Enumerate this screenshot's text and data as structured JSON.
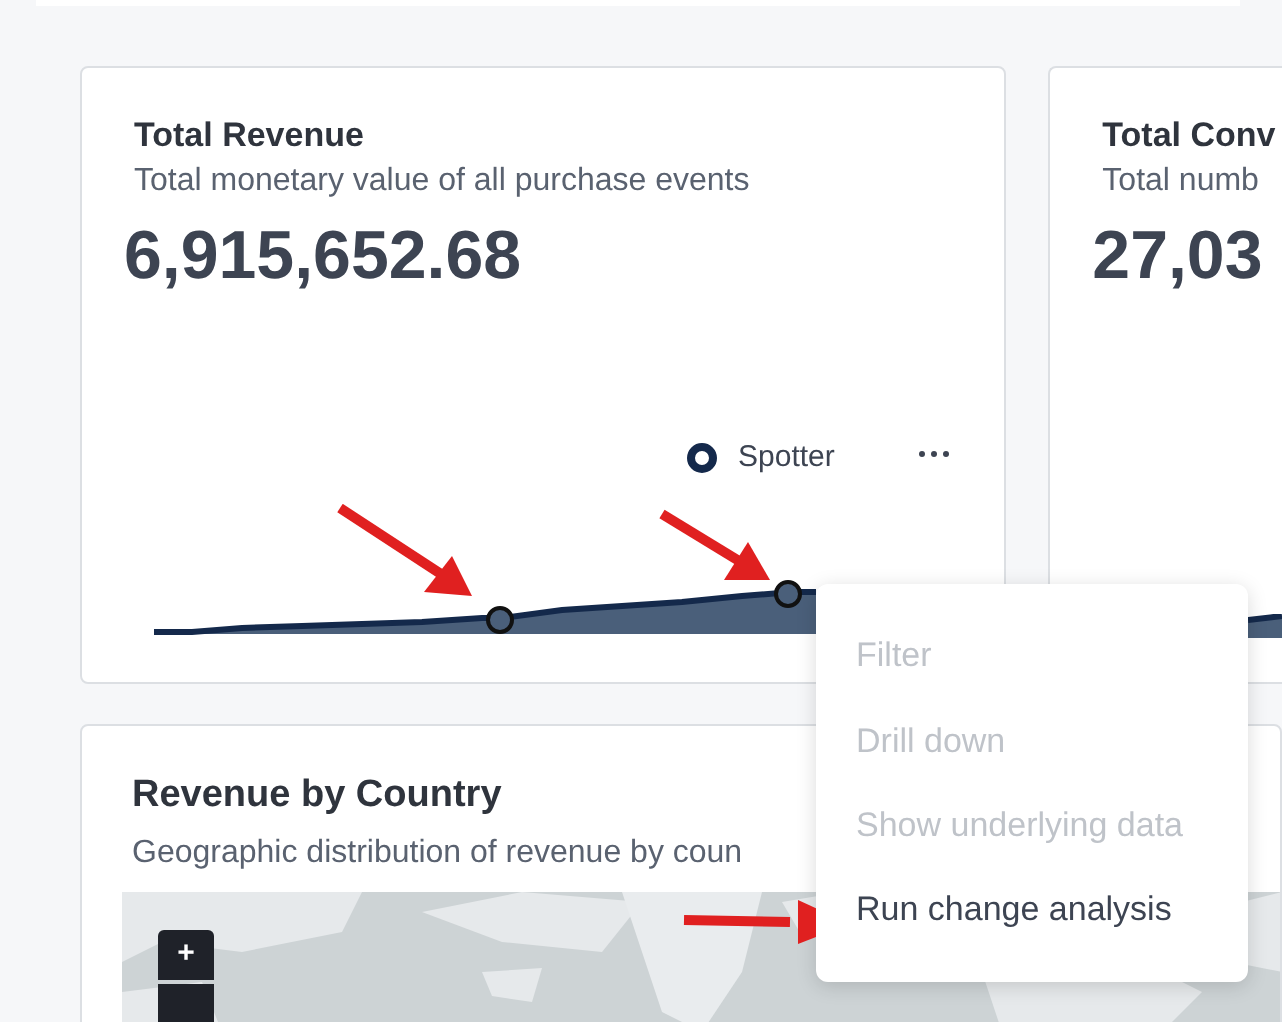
{
  "cards": [
    {
      "title": "Total Revenue",
      "subtitle": "Total monetary value of all purchase events",
      "value": "6,915,652.68",
      "legend": {
        "label": "Spotter"
      }
    },
    {
      "title": "Total Conv",
      "subtitle": "Total numb",
      "value": "27,03"
    }
  ],
  "map_card": {
    "title": "Revenue by Country",
    "subtitle": "Geographic distribution of revenue by coun",
    "zoom_in": "+"
  },
  "context_menu": [
    {
      "label": "Filter",
      "disabled": true
    },
    {
      "label": "Drill down",
      "disabled": true
    },
    {
      "label": "Show underlying data",
      "disabled": true
    },
    {
      "label": "Run change analysis",
      "disabled": false
    }
  ]
}
